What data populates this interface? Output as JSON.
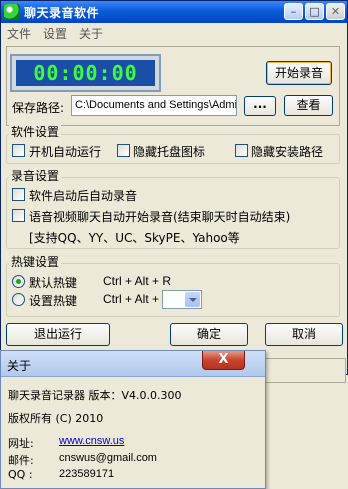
{
  "window": {
    "title": "聊天录音软件"
  },
  "menu": [
    "文件",
    "设置",
    "关于"
  ],
  "recorder": {
    "timer": "00:00:00",
    "record_button": "开始录音",
    "path_label": "保存路径:",
    "path_value": "C:\\Documents and Settings\\Admin",
    "browse_button": "...",
    "view_button": "查看"
  },
  "software_settings": {
    "title": "软件设置",
    "options": [
      "开机自动运行",
      "隐藏托盘图标",
      "隐藏安装路径"
    ]
  },
  "record_settings": {
    "title": "录音设置",
    "options": [
      "软件启动后自动录音",
      "语音视频聊天自动开始录音(结束聊天时自动结束)"
    ],
    "note": "[支持QQ、YY、UC、SkyPE、Yahoo等"
  },
  "hotkey_settings": {
    "title": "热键设置",
    "default_label": "默认热键",
    "default_keys": "Ctrl + Alt + R",
    "custom_label": "设置热键",
    "custom_keys": "Ctrl + Alt +",
    "selected": "default"
  },
  "buttons": {
    "exit": "退出运行",
    "ok": "确定",
    "cancel": "取消"
  },
  "about": {
    "title": "关于",
    "close": "X",
    "product": "聊天录音记录器  版本：V4.0.0.300",
    "copyright": "版权所有 (C) 2010",
    "website_label": "网址:",
    "website": "www.cnsw.us",
    "email_label": "邮件:",
    "email": "cnswus@gmail.com",
    "qq_label": "QQ :",
    "qq": "223589171"
  },
  "colors": {
    "titlebar": "#0a5bd8",
    "timer_bg": "#1a4fa8",
    "timer_fg": "#3dfc3d",
    "link": "#0000cc"
  }
}
